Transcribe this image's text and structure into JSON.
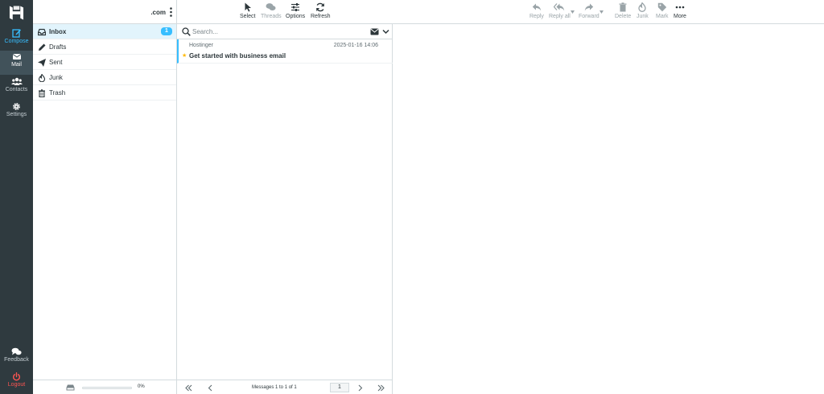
{
  "rail": {
    "items": [
      {
        "label": "Compose",
        "icon": "compose-icon"
      },
      {
        "label": "Mail",
        "icon": "envelope-icon"
      },
      {
        "label": "Contacts",
        "icon": "contacts-icon"
      },
      {
        "label": "Settings",
        "icon": "gear-icon"
      }
    ],
    "feedback": "Feedback",
    "logout": "Logout"
  },
  "account": {
    "name": ".com"
  },
  "folders": [
    {
      "name": "Inbox",
      "icon": "inbox-icon",
      "unread": "1"
    },
    {
      "name": "Drafts",
      "icon": "pencil-icon"
    },
    {
      "name": "Sent",
      "icon": "paper-plane-icon"
    },
    {
      "name": "Junk",
      "icon": "fire-icon"
    },
    {
      "name": "Trash",
      "icon": "trash-icon"
    }
  ],
  "quota": {
    "text": "0%",
    "fraction": 0
  },
  "list_toolbar": {
    "select": "Select",
    "threads": "Threads",
    "options": "Options",
    "refresh": "Refresh"
  },
  "search": {
    "placeholder": "Search..."
  },
  "messages": [
    {
      "from": "Hostinger",
      "date": "2025-01-16 14:06",
      "subject": "Get started with business email",
      "flag": "★"
    }
  ],
  "list_footer": {
    "count": "Messages 1 to 1 of 1",
    "page": "1"
  },
  "message_toolbar": {
    "reply": "Reply",
    "reply_all": "Reply all",
    "forward": "Forward",
    "delete": "Delete",
    "junk": "Junk",
    "mark": "Mark",
    "more": "More"
  },
  "colors": {
    "accent": "#37beff",
    "rail": "#2f3a3f",
    "logout": "#ff5552",
    "star": "#ffb900"
  }
}
